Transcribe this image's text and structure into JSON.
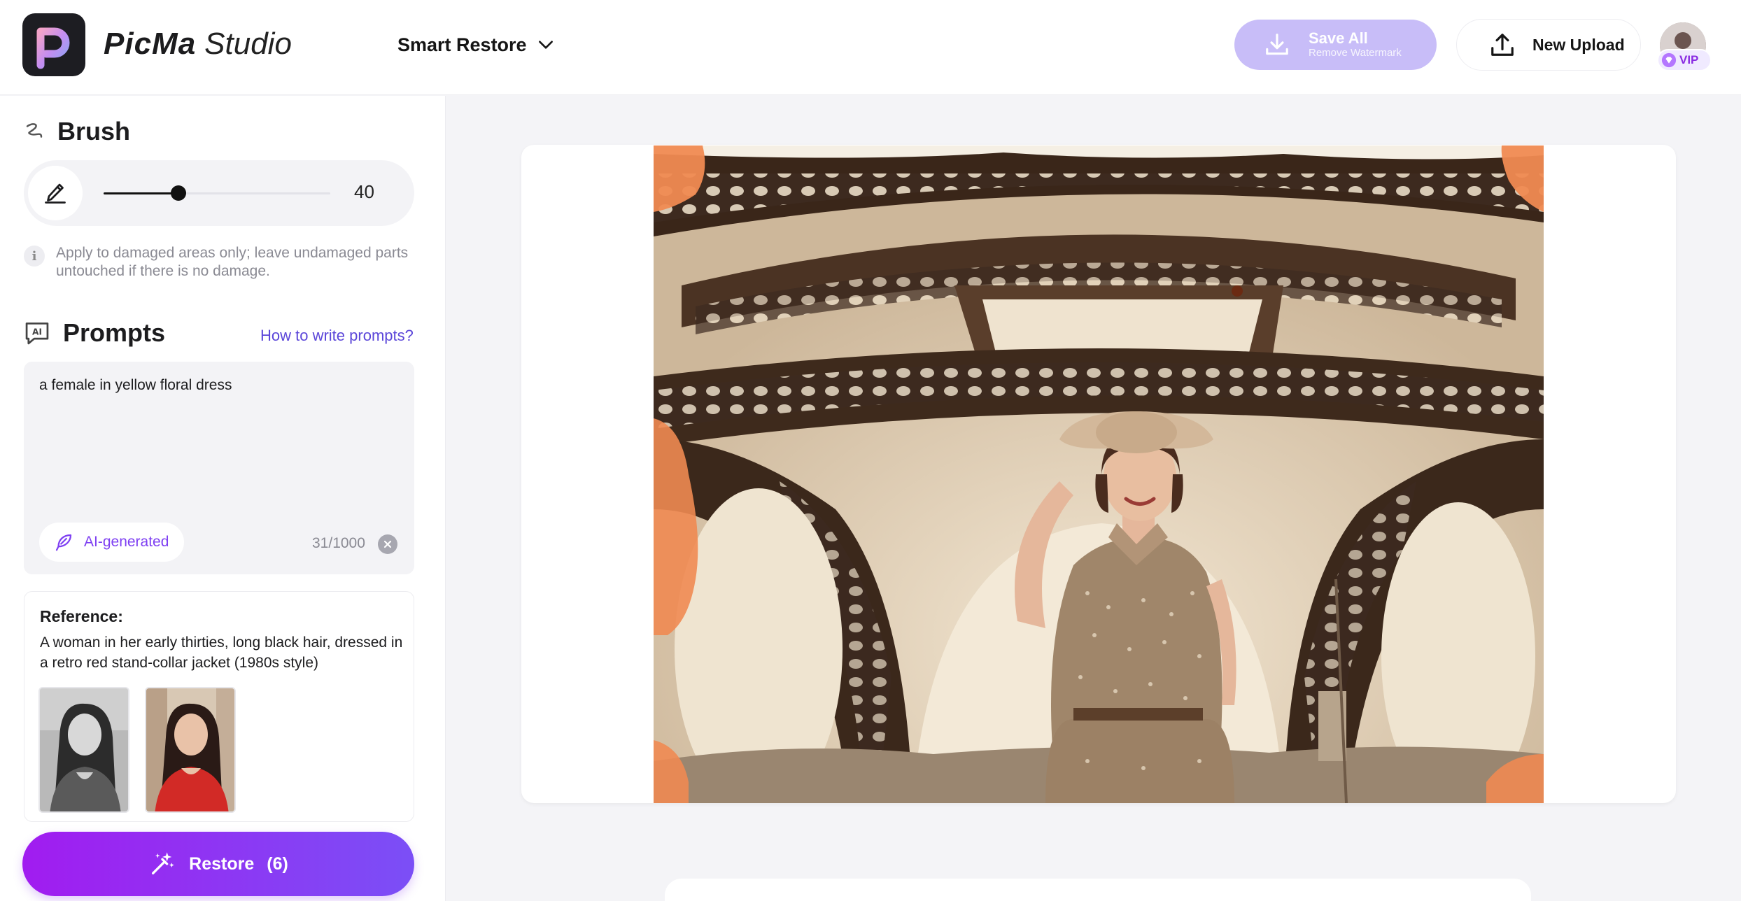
{
  "app": {
    "name_bold": "PicMa",
    "name_light": "Studio"
  },
  "header": {
    "mode_label": "Smart Restore",
    "save_all_label": "Save All",
    "save_all_sub": "Remove Watermark",
    "new_upload_label": "New Upload",
    "vip_label": "VIP"
  },
  "brush": {
    "title": "Brush",
    "size": 40,
    "size_fraction": 0.33,
    "hint": "Apply to damaged areas only; leave undamaged parts untouched if there is no damage."
  },
  "prompts": {
    "title": "Prompts",
    "help_link": "How to write prompts?",
    "text": "a female in yellow floral dress",
    "ai_chip": "AI-generated",
    "counter": "31/1000"
  },
  "reference": {
    "title": "Reference:",
    "text": "A woman in her early thirties, long black hair, dressed in a retro red stand-collar jacket (1980s style)"
  },
  "restore": {
    "label": "Restore",
    "count": "(6)"
  },
  "colors": {
    "accent": "#7b4ff6",
    "accent_start": "#a11cf0",
    "link": "#5b46d9",
    "save_disabled": "#c8bdf8"
  }
}
